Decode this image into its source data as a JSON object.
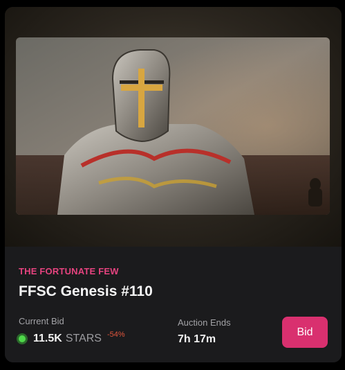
{
  "nft": {
    "collection": "THE FORTUNATE FEW",
    "title": "FFSC Genesis #110"
  },
  "current_bid": {
    "label": "Current Bid",
    "amount": "11.5K",
    "currency": "STARS",
    "change": "-54%"
  },
  "auction": {
    "label": "Auction Ends",
    "time_left": "7h 17m"
  },
  "actions": {
    "bid_label": "Bid"
  },
  "colors": {
    "accent": "#d9306f",
    "collection_text": "#e6437f",
    "status_dot": "#4fd84a",
    "negative_change": "#e0553c",
    "card_background": "#1b1b1d"
  }
}
